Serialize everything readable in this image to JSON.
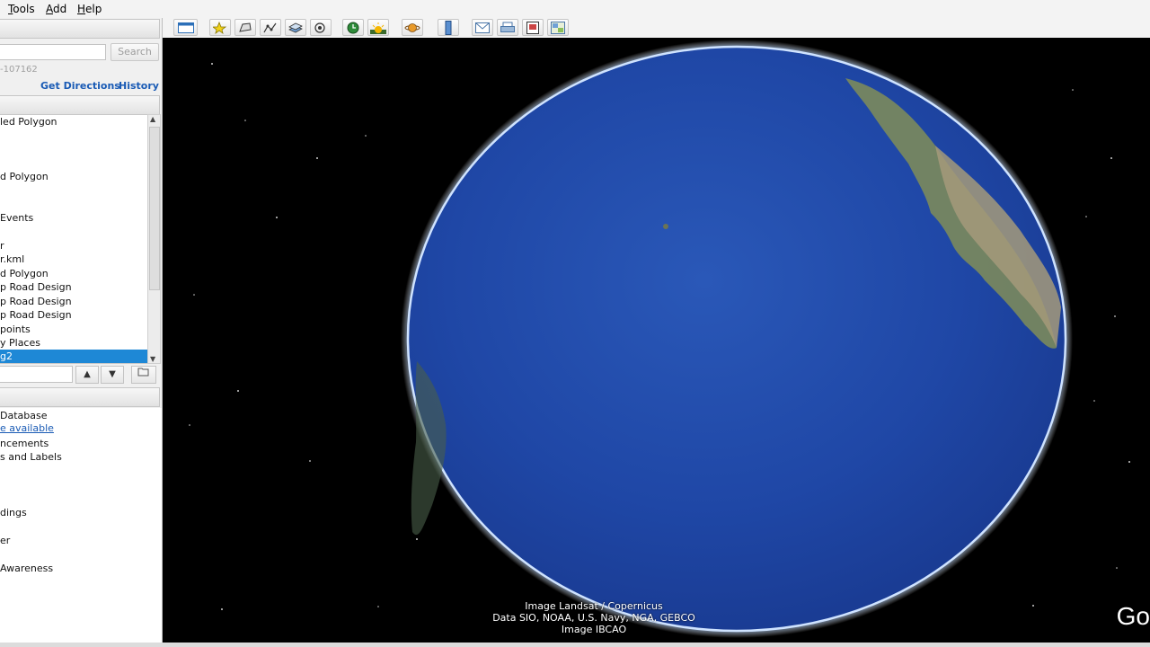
{
  "menu": {
    "tools": "Tools",
    "tools_key": "T",
    "tools_rest": "ools",
    "add_key": "A",
    "add_rest": "dd",
    "help_key": "H",
    "help_rest": "elp"
  },
  "search": {
    "button_label": "Search",
    "coords": "-107162",
    "get_directions": "Get Directions",
    "history": "History"
  },
  "places": {
    "items": [
      "led Polygon",
      "d Polygon",
      "Events",
      "r",
      "r.kml",
      "d Polygon",
      "p Road Design",
      "p Road Design",
      "p Road Design",
      "points",
      "y Places",
      "g2"
    ],
    "selected_index": 11
  },
  "layers": {
    "items": [
      {
        "label": "Database",
        "link": false
      },
      {
        "label": "e available",
        "link": true
      },
      {
        "label": "ncements",
        "link": false
      },
      {
        "label": "s and Labels",
        "link": false
      },
      {
        "label": "dings",
        "link": false
      },
      {
        "label": "er",
        "link": false
      },
      {
        "label": "Awareness",
        "link": false
      }
    ]
  },
  "toolbar": {
    "icons": [
      "sidebar-icon",
      "placemark-icon",
      "polygon-icon",
      "path-icon",
      "image-overlay-icon",
      "record-tour-icon",
      "historical-imagery-icon",
      "sunlight-icon",
      "planets-icon",
      "ruler-icon",
      "email-icon",
      "print-icon",
      "save-image-icon",
      "view-in-maps-icon"
    ]
  },
  "view": {
    "attribution_1": "Image Landsat / Copernicus",
    "attribution_2": "Data SIO, NOAA, U.S. Navy, NGA, GEBCO",
    "attribution_3": "Image IBCAO",
    "logo_partial": "Go"
  },
  "colors": {
    "selection": "#1e88d6",
    "link": "#1a5bb5",
    "ocean": "#1f47a6"
  }
}
